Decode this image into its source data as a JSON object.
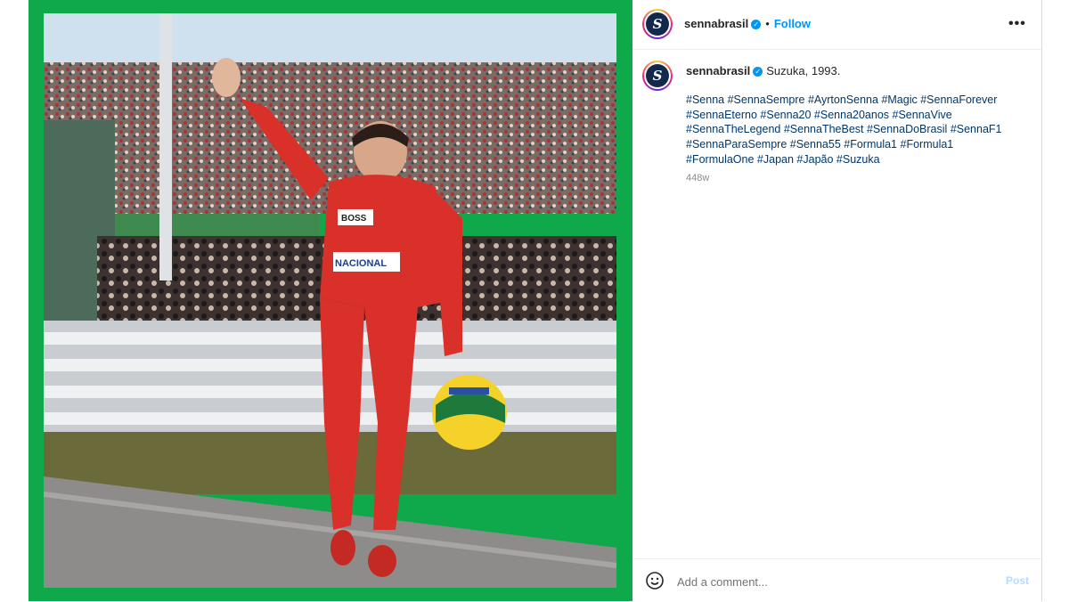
{
  "post": {
    "username": "sennabrasil",
    "follow_label": "Follow",
    "dot": "•",
    "more_label": "•••",
    "avatar_letter": "S",
    "caption": "Suzuka, 1993.",
    "hashtags": [
      "#Senna",
      "#SennaSempre",
      "#AyrtonSenna",
      "#Magic",
      "#SennaForever",
      "#SennaEterno",
      "#Senna20",
      "#Senna20anos",
      "#SennaVive",
      "#SennaTheLegend",
      "#SennaTheBest",
      "#SennaDoBrasil",
      "#SennaF1",
      "#SennaParaSempre",
      "#Senna55",
      "#Formula1",
      "#Formula1",
      "#FormulaOne",
      "#Japan",
      "#Japão",
      "#Suzuka"
    ],
    "timestamp": "448w",
    "frame_color": "#0fa84a"
  },
  "photo_labels": {
    "boss": "BOSS",
    "nacional": "NACIONAL"
  },
  "comment": {
    "placeholder": "Add a comment...",
    "post_label": "Post"
  },
  "colors": {
    "link": "#0095f6",
    "hashtag": "#00376b",
    "suit_red": "#d9302a"
  }
}
